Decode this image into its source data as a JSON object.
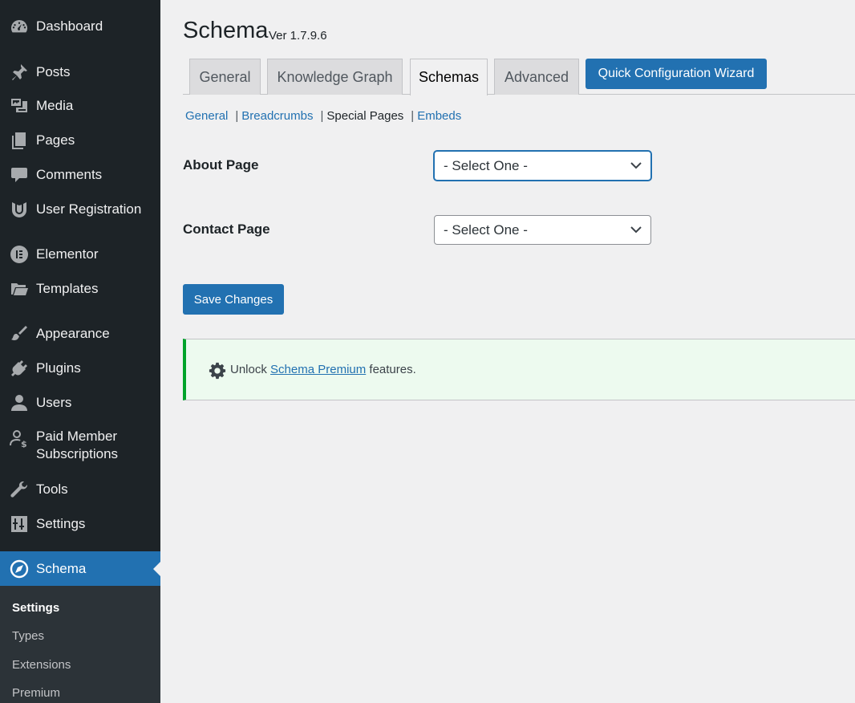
{
  "sidebar": {
    "items": [
      {
        "label": "Dashboard",
        "icon": "dashboard-icon"
      },
      {
        "label": "Posts",
        "icon": "pin-icon"
      },
      {
        "label": "Media",
        "icon": "media-icon"
      },
      {
        "label": "Pages",
        "icon": "pages-icon"
      },
      {
        "label": "Comments",
        "icon": "comment-icon"
      },
      {
        "label": "User Registration",
        "icon": "user-registration-icon"
      },
      {
        "label": "Elementor",
        "icon": "elementor-icon"
      },
      {
        "label": "Templates",
        "icon": "folder-icon"
      },
      {
        "label": "Appearance",
        "icon": "brush-icon"
      },
      {
        "label": "Plugins",
        "icon": "plug-icon"
      },
      {
        "label": "Users",
        "icon": "user-icon"
      },
      {
        "label": "Paid Member",
        "label2": "Subscriptions",
        "icon": "paid-member-icon"
      },
      {
        "label": "Tools",
        "icon": "wrench-icon"
      },
      {
        "label": "Settings",
        "icon": "sliders-icon"
      },
      {
        "label": "Schema",
        "icon": "compass-icon"
      }
    ],
    "submenu": [
      "Settings",
      "Types",
      "Extensions",
      "Premium"
    ],
    "active_color": "#2271b1",
    "bg_color": "#1d2327"
  },
  "header": {
    "title": "Schema",
    "version": "Ver 1.7.9.6"
  },
  "tabs": [
    {
      "label": "General"
    },
    {
      "label": "Knowledge Graph"
    },
    {
      "label": "Schemas"
    },
    {
      "label": "Advanced"
    }
  ],
  "wizard_label": "Quick Configuration Wizard",
  "subnav": {
    "links": [
      "General",
      "Breadcrumbs",
      "Special Pages",
      "Embeds"
    ],
    "sep": "|"
  },
  "form": {
    "about_label": "About Page",
    "about_value": "- Select One -",
    "contact_label": "Contact Page",
    "contact_value": "- Select One -"
  },
  "save_label": "Save Changes",
  "notice": {
    "prefix": "Unlock",
    "link": "Schema Premium",
    "suffix": "features.",
    "icon": "gear-icon",
    "border_color": "#00a32a"
  }
}
